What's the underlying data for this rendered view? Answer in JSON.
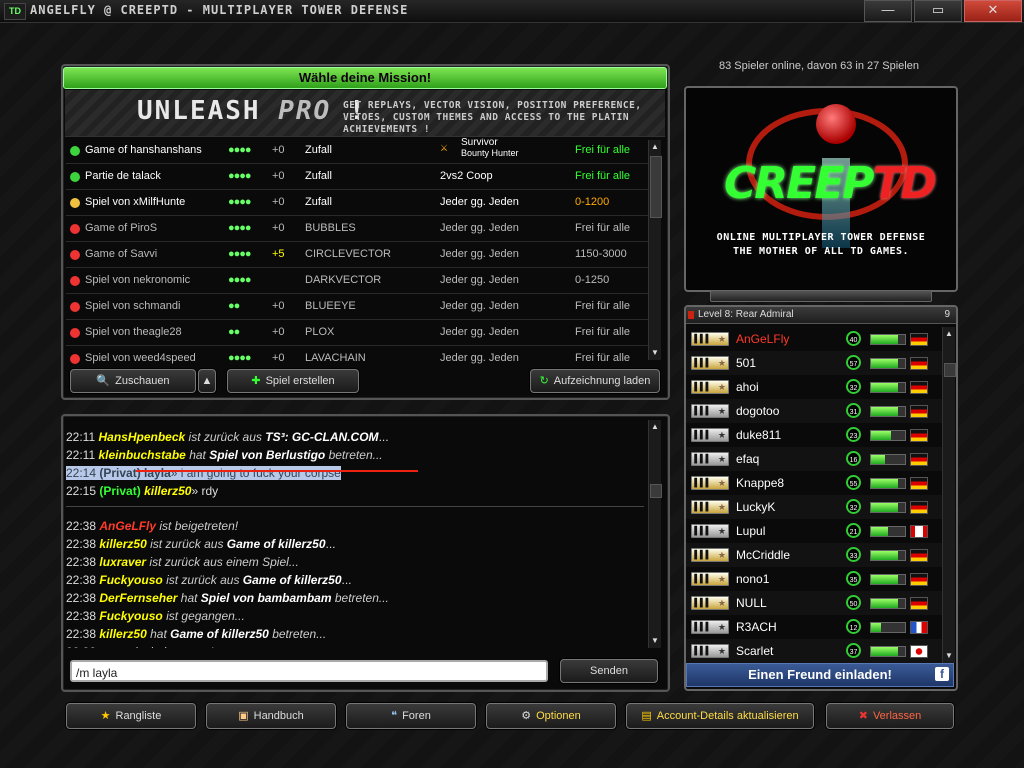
{
  "window": {
    "title": "ANGELFLY @ CREEPTD - MULTIPLAYER TOWER DEFENSE",
    "logo": "TD",
    "minimize": "—",
    "maximize": "▭",
    "close": "✕"
  },
  "mission": {
    "header": "Wähle deine Mission!",
    "banner_big_1": "UNLEASH ",
    "banner_big_2": "PRO",
    "banner_big_3": " !",
    "banner_small": "GET REPLAYS, VECTOR VISION, POSITION PREFERENCE, VETOES, CUSTOM THEMES AND ACCESS TO THE PLATIN ACHIEVEMENTS !",
    "games": [
      {
        "dot": "#3dd43d",
        "name": "Game of hanshanshans",
        "players": "●●●●",
        "plus": "+0",
        "map": "Zufall",
        "mode": "",
        "mode_a": "Survivor",
        "mode_b": "Bounty Hunter",
        "range": "Frei für alle",
        "rc": "g",
        "dim": false
      },
      {
        "dot": "#3dd43d",
        "name": "Partie de talack",
        "players": "●●●●",
        "plus": "+0",
        "map": "Zufall",
        "mode": "2vs2 Coop",
        "mode_a": "",
        "mode_b": "",
        "range": "Frei für alle",
        "rc": "g",
        "dim": false
      },
      {
        "dot": "#f0c040",
        "name": "Spiel von xMilfHunte",
        "players": "●●●●",
        "plus": "+0",
        "map": "Zufall",
        "mode": "Jeder gg. Jeden",
        "mode_a": "",
        "mode_b": "",
        "range": "0-1200",
        "rc": "o",
        "dim": false
      },
      {
        "dot": "#e33",
        "name": "Game of PiroS",
        "players": "●●●●",
        "plus": "+0",
        "map": "BUBBLES",
        "mode": "Jeder gg. Jeden",
        "mode_a": "",
        "mode_b": "",
        "range": "Frei für alle",
        "rc": "w",
        "dim": true
      },
      {
        "dot": "#e33",
        "name": "Game of Savvi",
        "players": "●●●●",
        "plus": "+5",
        "map": "CIRCLEVECTOR",
        "mode": "Jeder gg. Jeden",
        "mode_a": "",
        "mode_b": "",
        "range": "1150-3000",
        "rc": "w",
        "dim": true,
        "plusy": true
      },
      {
        "dot": "#e33",
        "name": "Spiel von nekronomic",
        "players": "●●●●",
        "plus": "",
        "map": "DARKVECTOR",
        "mode": "Jeder gg. Jeden",
        "mode_a": "",
        "mode_b": "",
        "range": "0-1250",
        "rc": "w",
        "dim": true
      },
      {
        "dot": "#e33",
        "name": "Spiel von schmandi",
        "players": "●●",
        "plus": "+0",
        "map": "BLUEEYE",
        "mode": "Jeder gg. Jeden",
        "mode_a": "",
        "mode_b": "",
        "range": "Frei für alle",
        "rc": "w",
        "dim": true
      },
      {
        "dot": "#e33",
        "name": "Spiel von theagle28",
        "players": "●●",
        "plus": "+0",
        "map": "PLOX",
        "mode": "Jeder gg. Jeden",
        "mode_a": "",
        "mode_b": "",
        "range": "Frei für alle",
        "rc": "w",
        "dim": true
      },
      {
        "dot": "#e33",
        "name": "Spiel von weed4speed",
        "players": "●●●●",
        "plus": "+0",
        "map": "LAVACHAIN",
        "mode": "Jeder gg. Jeden",
        "mode_a": "",
        "mode_b": "",
        "range": "Frei für alle",
        "rc": "w",
        "dim": true
      }
    ],
    "btn_watch": "Zuschauen",
    "btn_create": "Spiel erstellen",
    "btn_replay": "Aufzeichnung laden"
  },
  "chat": {
    "input_value": "/m layla",
    "send": "Senden"
  },
  "right": {
    "online": "83 Spieler online, davon 63 in 27 Spielen",
    "promo_logo_a": "CREEP",
    "promo_logo_b": "TD",
    "promo_sub1": "ONLINE MULTIPLAYER TOWER DEFENSE",
    "promo_sub2": "THE MOTHER OF ALL TD GAMES.",
    "list_head": "Level 8: Rear Admiral",
    "list_count": "9",
    "users": [
      {
        "name": "AnGeLFly",
        "lvl": "40",
        "fill": 0.8,
        "flag": "fde",
        "gold": true,
        "red": true
      },
      {
        "name": "501",
        "lvl": "57",
        "fill": 0.8,
        "flag": "fde",
        "gold": true
      },
      {
        "name": "ahoi",
        "lvl": "32",
        "fill": 0.8,
        "flag": "fde",
        "gold": true
      },
      {
        "name": "dogotoo",
        "lvl": "31",
        "fill": 0.8,
        "flag": "fde",
        "gold": false
      },
      {
        "name": "duke811",
        "lvl": "23",
        "fill": 0.6,
        "flag": "fde",
        "gold": false
      },
      {
        "name": "efaq",
        "lvl": "16",
        "fill": 0.4,
        "flag": "fde",
        "gold": false
      },
      {
        "name": "Knappe8",
        "lvl": "55",
        "fill": 0.8,
        "flag": "fde",
        "gold": true
      },
      {
        "name": "LuckyK",
        "lvl": "32",
        "fill": 0.8,
        "flag": "fde",
        "gold": true
      },
      {
        "name": "Lupul",
        "lvl": "21",
        "fill": 0.5,
        "flag": "fca",
        "gold": false
      },
      {
        "name": "McCriddle",
        "lvl": "33",
        "fill": 0.8,
        "flag": "fde",
        "gold": true
      },
      {
        "name": "nono1",
        "lvl": "35",
        "fill": 0.8,
        "flag": "fde",
        "gold": true
      },
      {
        "name": "NULL",
        "lvl": "50",
        "fill": 0.8,
        "flag": "fde",
        "gold": true
      },
      {
        "name": "R3ACH",
        "lvl": "12",
        "fill": 0.3,
        "flag": "ffr",
        "gold": false
      },
      {
        "name": "Scarlet",
        "lvl": "37",
        "fill": 0.8,
        "flag": "fjp",
        "gold": false
      }
    ],
    "invite": "Einen Freund einladen!"
  },
  "bottom": {
    "rank": "Rangliste",
    "manual": "Handbuch",
    "forum": "Foren",
    "options": "Optionen",
    "account": "Account-Details aktualisieren",
    "leave": "Verlassen"
  }
}
